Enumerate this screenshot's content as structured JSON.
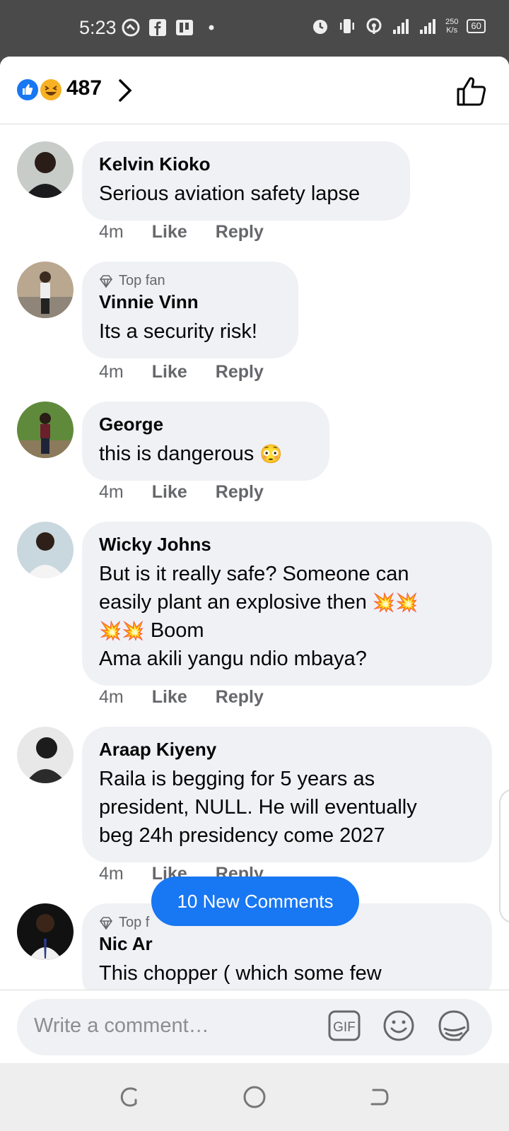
{
  "status_bar": {
    "time": "5:23",
    "net_speed_value": "250",
    "net_speed_unit": "K/s",
    "battery": "60",
    "network": "4G",
    "left_icons": [
      "vpn-icon",
      "facebook-icon",
      "app-icon",
      "dot-icon"
    ],
    "right_icons": [
      "alarm-icon",
      "vibrate-icon",
      "hotspot-icon",
      "signal-icon",
      "signal-4g-icon"
    ]
  },
  "header": {
    "reaction_count": "487",
    "reactions": [
      "like",
      "haha"
    ]
  },
  "comments": [
    {
      "author": "Kelvin Kioko",
      "top_fan": "",
      "text": "Serious aviation safety lapse",
      "time": "4m",
      "like": "Like",
      "reply": "Reply"
    },
    {
      "author": "Vinnie Vinn",
      "top_fan": "Top fan",
      "text": "Its a security risk!",
      "time": "4m",
      "like": "Like",
      "reply": "Reply"
    },
    {
      "author": "George",
      "top_fan": "",
      "text": "this is dangerous",
      "emoji": "😳",
      "time": "4m",
      "like": "Like",
      "reply": "Reply"
    },
    {
      "author": "Wicky Johns",
      "top_fan": "",
      "text_line1": "But is it really safe? Someone can",
      "text_line2": "easily plant an explosive then",
      "emoji_line2": "💥💥",
      "emoji_line3": "💥💥",
      "text_line3": "Boom",
      "text_line4": "Ama akili yangu ndio mbaya?",
      "time": "4m",
      "like": "Like",
      "reply": "Reply"
    },
    {
      "author": "Araap Kiyeny",
      "top_fan": "",
      "text_line1": "Raila is begging for 5 years as",
      "text_line2": "president, NULL. He will eventually",
      "text_line3": "beg 24h presidency come 2027",
      "time": "4m",
      "like": "Like",
      "reply": "Reply"
    },
    {
      "author": "Nic Ar",
      "top_fan": "Top f",
      "text": "This chopper ( which some few"
    }
  ],
  "new_comments_label": "10 New Comments",
  "composer": {
    "placeholder": "Write a comment…",
    "gif_label": "GIF"
  },
  "colors": {
    "accent": "#1877f2",
    "bubble": "#f0f1f5",
    "meta_text": "#65676b",
    "status_bar": "#4a4a4a"
  }
}
